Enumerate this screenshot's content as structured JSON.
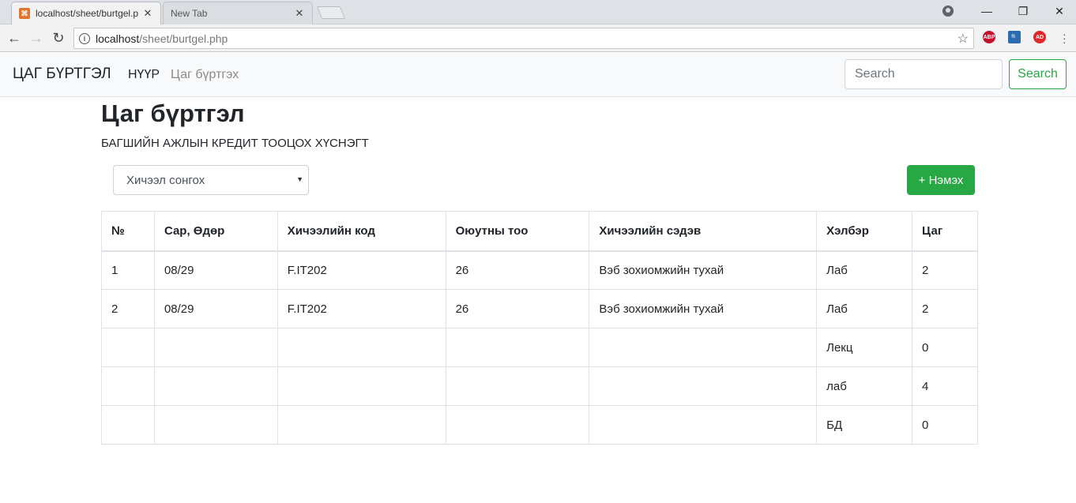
{
  "browser": {
    "active_tab_title": "localhost/sheet/burtgel.p",
    "inactive_tab_title": "New Tab",
    "url_host": "localhost",
    "url_path": "/sheet/burtgel.php",
    "extensions": [
      {
        "name": "adblock-plus-icon",
        "text": "ABP",
        "color": "#c70d2c"
      },
      {
        "name": "search-extension-icon",
        "text": "🔍",
        "color": "#2a6db5"
      },
      {
        "name": "ad-extension-icon",
        "text": "AD",
        "color": "#e0262b"
      }
    ]
  },
  "navbar": {
    "brand": "ЦАГ БҮРТГЭЛ",
    "home": "НҮҮР",
    "register": "Цаг бүртгэх",
    "search_placeholder": "Search",
    "search_button": "Search"
  },
  "page": {
    "title": "Цаг бүртгэл",
    "subtitle": "БАГШИЙН АЖЛЫН КРЕДИТ ТООЦОХ ХҮСНЭГТ",
    "select_value": "Хичээл сонгох",
    "add_button": "+ Нэмэх"
  },
  "table": {
    "headers": [
      "№",
      "Сар, Өдөр",
      "Хичээлийн код",
      "Оюутны тоо",
      "Хичээлийн сэдэв",
      "Хэлбэр",
      "Цаг"
    ],
    "rows": [
      [
        "1",
        "08/29",
        "F.IT202",
        "26",
        "Вэб зохиомжийн тухай",
        "Лаб",
        "2"
      ],
      [
        "2",
        "08/29",
        "F.IT202",
        "26",
        "Вэб зохиомжийн тухай",
        "Лаб",
        "2"
      ],
      [
        "",
        "",
        "",
        "",
        "",
        "Лекц",
        "0"
      ],
      [
        "",
        "",
        "",
        "",
        "",
        "лаб",
        "4"
      ],
      [
        "",
        "",
        "",
        "",
        "",
        "БД",
        "0"
      ]
    ]
  }
}
